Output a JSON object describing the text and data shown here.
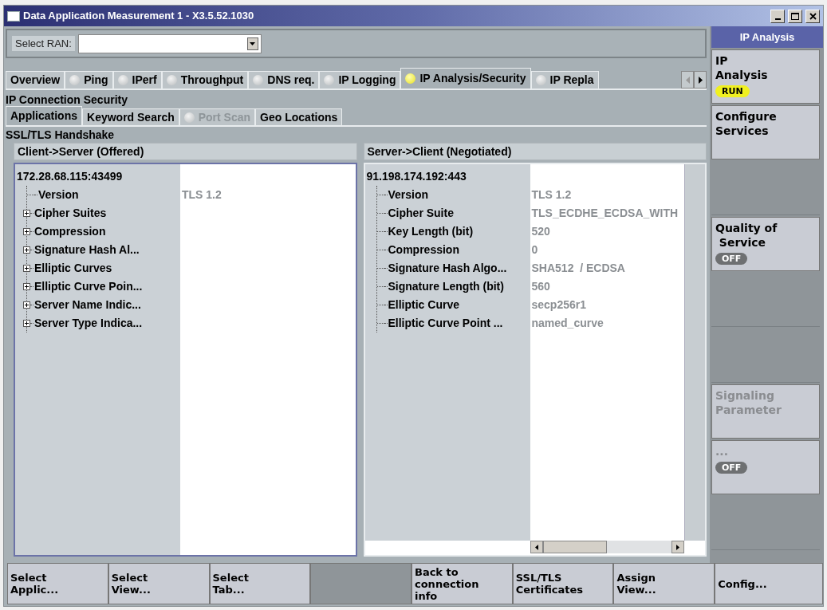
{
  "window": {
    "title": "Data Application Measurement 1 - X3.5.52.1030"
  },
  "ran_selector": {
    "label": "Select RAN:"
  },
  "tabs": [
    {
      "label": "Overview",
      "selected": false
    },
    {
      "label": "Ping",
      "selected": false,
      "led_on": false
    },
    {
      "label": "IPerf",
      "selected": false,
      "led_on": false
    },
    {
      "label": "Throughput",
      "selected": false,
      "led_on": false
    },
    {
      "label": "DNS req.",
      "selected": false,
      "led_on": false
    },
    {
      "label": "IP Logging",
      "selected": false,
      "led_on": false
    },
    {
      "label": "IP Analysis/Security",
      "selected": true,
      "led_on": true
    },
    {
      "label": "IP Repla",
      "selected": false,
      "led_on": false
    }
  ],
  "section_title": "IP Connection Security",
  "subtabs": [
    {
      "label": "Applications",
      "selected": true,
      "disabled": false
    },
    {
      "label": "Keyword Search",
      "selected": false,
      "disabled": false
    },
    {
      "label": "Port Scan",
      "selected": false,
      "disabled": true,
      "led_on": false
    },
    {
      "label": "Geo Locations",
      "selected": false,
      "disabled": false
    }
  ],
  "subsection_title": "SSL/TLS Handshake",
  "panels": [
    {
      "title": "Client->Server (Offered)",
      "root": "172.28.68.115:43499",
      "scrollbars": false,
      "items": [
        {
          "label": "Version",
          "expandable": false,
          "value": "TLS 1.2"
        },
        {
          "label": "Cipher Suites",
          "expandable": true
        },
        {
          "label": "Compression",
          "expandable": true
        },
        {
          "label": "Signature Hash Al...",
          "expandable": true
        },
        {
          "label": "Elliptic Curves",
          "expandable": true
        },
        {
          "label": "Elliptic Curve Poin...",
          "expandable": true
        },
        {
          "label": "Server Name Indic...",
          "expandable": true
        },
        {
          "label": "Server Type Indica...",
          "expandable": true
        }
      ]
    },
    {
      "title": "Server->Client (Negotiated)",
      "root": "91.198.174.192:443",
      "scrollbars": true,
      "items": [
        {
          "label": "Version",
          "expandable": false,
          "value": "TLS 1.2"
        },
        {
          "label": "Cipher Suite",
          "expandable": false,
          "value": "TLS_ECDHE_ECDSA_WITH"
        },
        {
          "label": "Key Length (bit)",
          "expandable": false,
          "value": "520"
        },
        {
          "label": "Compression",
          "expandable": false,
          "value": "0"
        },
        {
          "label": "Signature Hash Algo...",
          "expandable": false,
          "value": "SHA512  / ECDSA"
        },
        {
          "label": "Signature Length (bit)",
          "expandable": false,
          "value": "560"
        },
        {
          "label": "Elliptic Curve",
          "expandable": false,
          "value": "secp256r1"
        },
        {
          "label": "Elliptic Curve Point ...",
          "expandable": false,
          "value": "named_curve"
        }
      ]
    }
  ],
  "side_keys": {
    "header": "IP Analysis",
    "keys": [
      {
        "kind": "key",
        "lines": [
          "IP",
          "Analysis"
        ],
        "disabled": false,
        "badge": {
          "text": "RUN",
          "running": true
        }
      },
      {
        "kind": "key",
        "lines": [
          "Configure",
          "Services"
        ],
        "disabled": false
      },
      {
        "kind": "blank"
      },
      {
        "kind": "key",
        "lines": [
          "Quality of",
          " Service"
        ],
        "disabled": false,
        "badge": {
          "text": "OFF",
          "running": false
        }
      },
      {
        "kind": "blank"
      },
      {
        "kind": "blank"
      },
      {
        "kind": "key",
        "lines": [
          "Signaling",
          "Parameter"
        ],
        "disabled": true
      },
      {
        "kind": "key",
        "lines": [
          "..."
        ],
        "disabled": true,
        "badge": {
          "text": "OFF",
          "running": false
        }
      },
      {
        "kind": "blank"
      }
    ]
  },
  "bottom_keys": [
    {
      "kind": "key",
      "lines": [
        "Select",
        "Applic..."
      ]
    },
    {
      "kind": "key",
      "lines": [
        "Select",
        "View..."
      ]
    },
    {
      "kind": "key",
      "lines": [
        "Select",
        "Tab..."
      ]
    },
    {
      "kind": "blank"
    },
    {
      "kind": "key",
      "lines": [
        "Back to",
        "connection",
        "info"
      ]
    },
    {
      "kind": "key",
      "lines": [
        "SSL/TLS",
        "Certificates"
      ]
    },
    {
      "kind": "key",
      "lines": [
        "Assign",
        "View..."
      ]
    },
    {
      "kind": "key",
      "lines": [
        "Config..."
      ]
    }
  ]
}
